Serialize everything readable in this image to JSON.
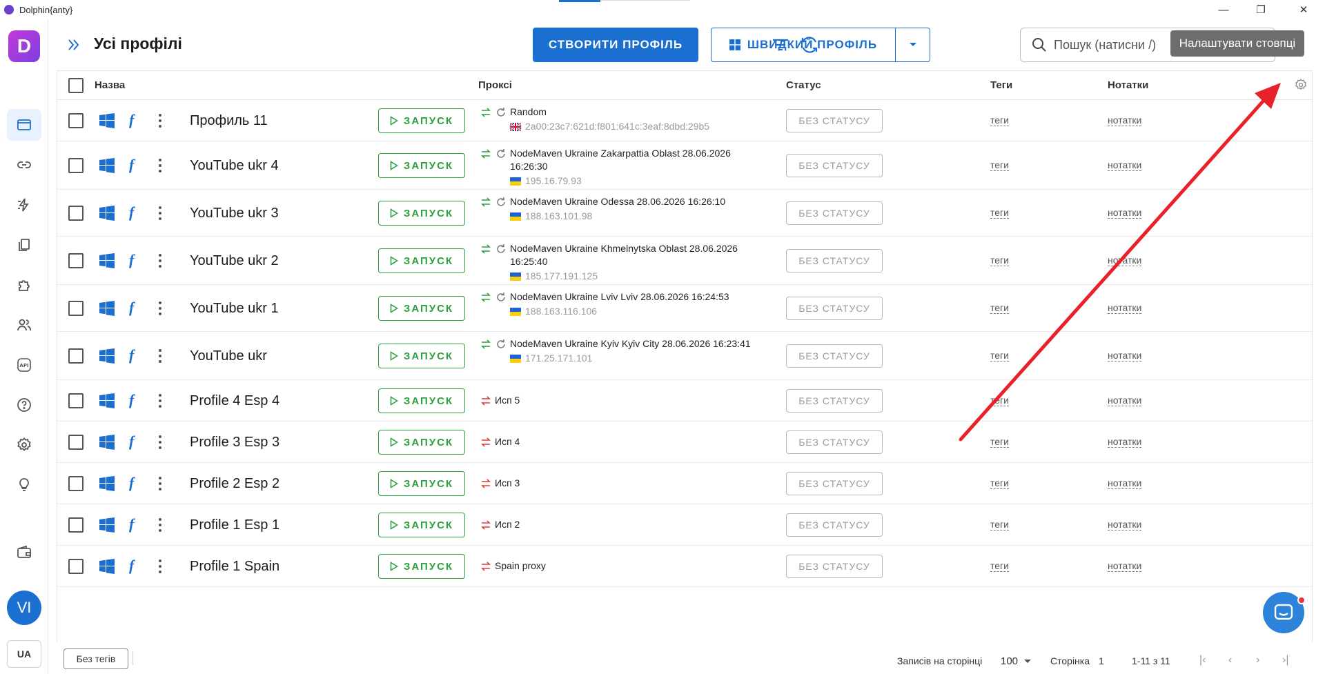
{
  "app": {
    "title": "Dolphin{anty}"
  },
  "sidebar": {
    "avatar": "VI",
    "language": "UA"
  },
  "header": {
    "title": "Усі профілі",
    "create_label": "СТВОРИТИ ПРОФІЛЬ",
    "quick_label": "ШВИДКИЙ ПРОФІЛЬ",
    "search_placeholder": "Пошук (натисни /)",
    "tooltip": "Налаштувати стовпці"
  },
  "columns": {
    "name": "Назва",
    "proxy": "Проксі",
    "status": "Статус",
    "tags": "Теги",
    "notes": "Нотатки"
  },
  "run_label": "ЗАПУСК",
  "status_label": "БЕЗ СТАТУСУ",
  "tags_label": "теги",
  "notes_label": "нотатки",
  "rows": [
    {
      "name": "Профиль 11",
      "proxy": "Random",
      "ip": "2a00:23c7:621d:f801:641c:3eaf:8dbd:29b5",
      "flag": "gb",
      "proxy_state": "ok"
    },
    {
      "name": "YouTube ukr 4",
      "proxy": "NodeMaven Ukraine Zakarpattia Oblast 28.06.2026 16:26:30",
      "ip": "195.16.79.93",
      "flag": "ua",
      "proxy_state": "ok"
    },
    {
      "name": "YouTube ukr 3",
      "proxy": "NodeMaven Ukraine Odessa 28.06.2026 16:26:10",
      "ip": "188.163.101.98",
      "flag": "ua",
      "proxy_state": "ok"
    },
    {
      "name": "YouTube ukr 2",
      "proxy": "NodeMaven Ukraine Khmelnytska Oblast 28.06.2026 16:25:40",
      "ip": "185.177.191.125",
      "flag": "ua",
      "proxy_state": "ok"
    },
    {
      "name": "YouTube ukr 1",
      "proxy": "NodeMaven Ukraine Lviv Lviv 28.06.2026 16:24:53",
      "ip": "188.163.116.106",
      "flag": "ua",
      "proxy_state": "ok"
    },
    {
      "name": "YouTube ukr",
      "proxy": "NodeMaven Ukraine Kyiv Kyiv City 28.06.2026 16:23:41",
      "ip": "171.25.171.101",
      "flag": "ua",
      "proxy_state": "ok"
    },
    {
      "name": "Profile 4 Esp 4",
      "proxy": "Исп 5",
      "ip": "",
      "flag": "",
      "proxy_state": "error"
    },
    {
      "name": "Profile 3 Esp 3",
      "proxy": "Исп 4",
      "ip": "",
      "flag": "",
      "proxy_state": "error"
    },
    {
      "name": "Profile 2 Esp 2",
      "proxy": "Исп 3",
      "ip": "",
      "flag": "",
      "proxy_state": "error"
    },
    {
      "name": "Profile 1 Esp 1",
      "proxy": "Исп 2",
      "ip": "",
      "flag": "",
      "proxy_state": "error"
    },
    {
      "name": "Profile 1 Spain",
      "proxy": "Spain proxy",
      "ip": "",
      "flag": "",
      "proxy_state": "error"
    }
  ],
  "footer": {
    "no_tags": "Без тегів",
    "per_page_label": "Записів на сторінці",
    "per_page_value": "100",
    "page_label": "Сторінка",
    "page_value": "1",
    "range": "1-11 з 11"
  },
  "colors": {
    "accent": "#1b6fd1",
    "run": "#2e9e3e",
    "proxy_ok": "#2e9e3e",
    "proxy_error": "#e53935",
    "annotation": "#e8212b"
  }
}
